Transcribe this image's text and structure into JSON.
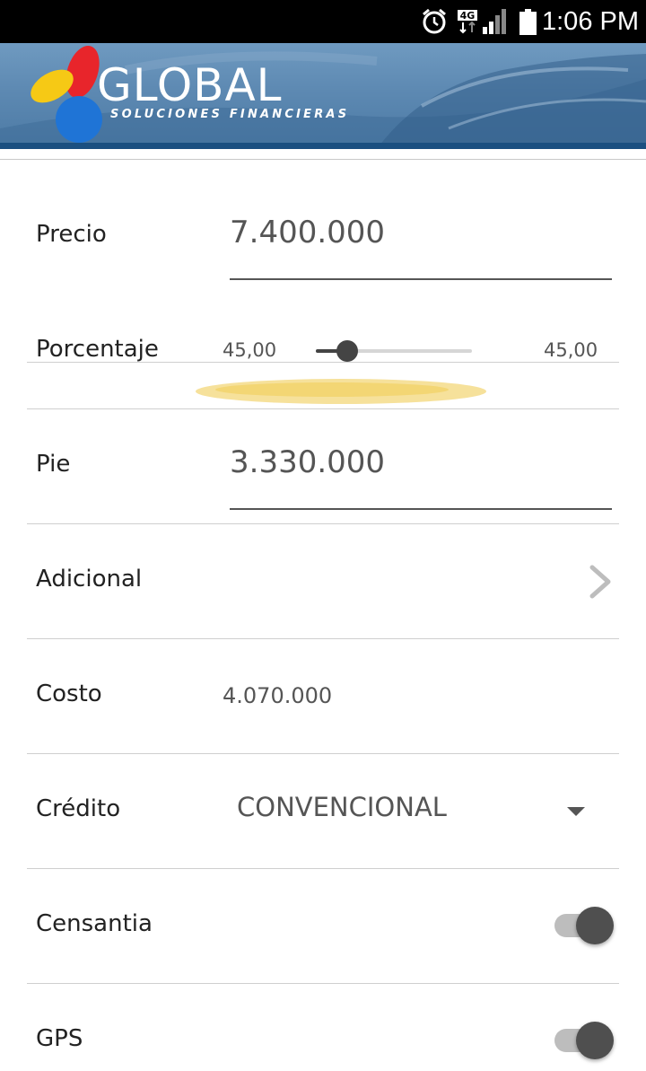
{
  "status_bar": {
    "time": "1:06 PM",
    "network_label": "4G",
    "icons": [
      "alarm-icon",
      "4g-data-icon",
      "signal-icon",
      "battery-icon"
    ]
  },
  "header": {
    "brand": "GLOBAL",
    "tagline": "SOLUCIONES FINANCIERAS",
    "colors": {
      "logo_red": "#e8252b",
      "logo_yellow": "#f6c915",
      "logo_blue": "#1f74d6",
      "strip": "#1b4f80"
    }
  },
  "form": {
    "precio": {
      "label": "Precio",
      "value": "7.400.000"
    },
    "porcentaje": {
      "label": "Porcentaje",
      "min_label": "45,00",
      "max_label": "45,00",
      "slider_fraction": 0.2
    },
    "pie": {
      "label": "Pie",
      "value": "3.330.000"
    },
    "adicional": {
      "label": "Adicional",
      "icon": "chevron-right-icon"
    },
    "costo": {
      "label": "Costo",
      "value": "4.070.000"
    },
    "credito": {
      "label": "Crédito",
      "selected": "CONVENCIONAL",
      "icon": "dropdown-arrow-icon"
    },
    "censantia": {
      "label": "Censantia",
      "enabled": true
    },
    "gps": {
      "label": "GPS",
      "enabled": true
    }
  }
}
